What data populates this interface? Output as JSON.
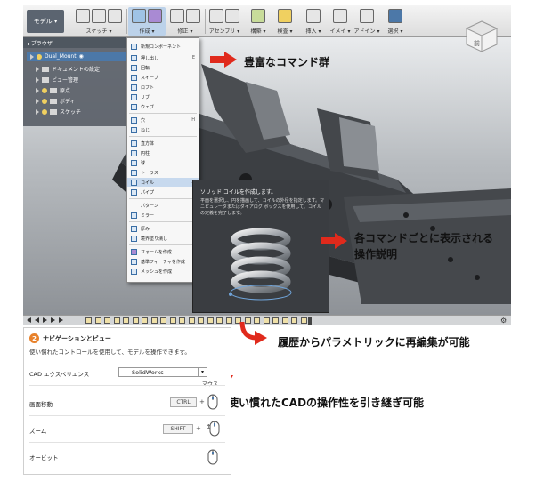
{
  "app": {
    "mode_label": "モデル ▾",
    "toolbar_groups": [
      {
        "label": "スケッチ ▾"
      },
      {
        "label": "作成 ▾",
        "active": true
      },
      {
        "label": "修正 ▾"
      },
      {
        "label": "アセンブリ ▾"
      },
      {
        "label": "構築 ▾"
      },
      {
        "label": "検査 ▾"
      },
      {
        "label": "挿入 ▾"
      },
      {
        "label": "イメイ ▾"
      },
      {
        "label": "アドイン ▾"
      },
      {
        "label": "選択 ▾"
      }
    ],
    "browser": {
      "header": "ブラウザ",
      "root": "Dual_Mount",
      "items": [
        "ドキュメントの設定",
        "ビュー管理",
        "原点",
        "ボディ",
        "スケッチ"
      ]
    },
    "menu": {
      "items": [
        {
          "label": "新規コンポーネント",
          "shortcut": ""
        },
        {
          "label": "押し出し",
          "shortcut": "E"
        },
        {
          "label": "回転",
          "shortcut": ""
        },
        {
          "label": "スイープ",
          "shortcut": ""
        },
        {
          "label": "ロフト",
          "shortcut": ""
        },
        {
          "label": "リブ",
          "shortcut": ""
        },
        {
          "label": "ウェブ",
          "shortcut": ""
        },
        {
          "label": "穴",
          "shortcut": "H"
        },
        {
          "label": "ねじ",
          "shortcut": ""
        },
        {
          "label": "直方体",
          "shortcut": ""
        },
        {
          "label": "円柱",
          "shortcut": ""
        },
        {
          "label": "球",
          "shortcut": ""
        },
        {
          "label": "トーラス",
          "shortcut": ""
        },
        {
          "label": "コイル",
          "shortcut": ""
        },
        {
          "label": "パイプ",
          "shortcut": ""
        },
        {
          "label": "パターン",
          "shortcut": "▸"
        },
        {
          "label": "ミラー",
          "shortcut": ""
        },
        {
          "label": "厚み",
          "shortcut": ""
        },
        {
          "label": "境界塗り潰し",
          "shortcut": ""
        },
        {
          "label": "フォームを作成",
          "shortcut": ""
        },
        {
          "label": "基準フィーチャを作成",
          "shortcut": ""
        },
        {
          "label": "メッシュを作成",
          "shortcut": ""
        }
      ]
    },
    "tooltip": {
      "title": "ソリッド コイルを作成します。",
      "body": "平面を選択し、円を描画して、コイルの外径を指定します。マニピュレータまたはダイアログ ボックスを使用して、コイルの定義を完了します。"
    },
    "viewcube_label": "前"
  },
  "callouts": {
    "commands": "豊富なコマンド群",
    "help_line1": "各コマンドごとに表示される",
    "help_line2": "操作説明",
    "history": "履歴からパラメトリックに再編集が可能",
    "cad": "使い慣れたCADの操作性を引き継ぎ可能"
  },
  "settings": {
    "number": "2",
    "title": "ナビゲーションとビュー",
    "description": "使い慣れたコントロールを使用して、モデルを操作できます。",
    "cad_label": "CAD エクスペリエンス",
    "cad_value": "SolidWorks",
    "mouse_header": "マウス",
    "rows": [
      {
        "label": "画面移動",
        "key": "CTRL"
      },
      {
        "label": "ズーム",
        "key": "SHIFT"
      },
      {
        "label": "オービット",
        "key": ""
      }
    ]
  },
  "colors": {
    "accent_red": "#e02a1c",
    "number_badge": "#e8812a",
    "menu_highlight": "#c7d9ee"
  }
}
